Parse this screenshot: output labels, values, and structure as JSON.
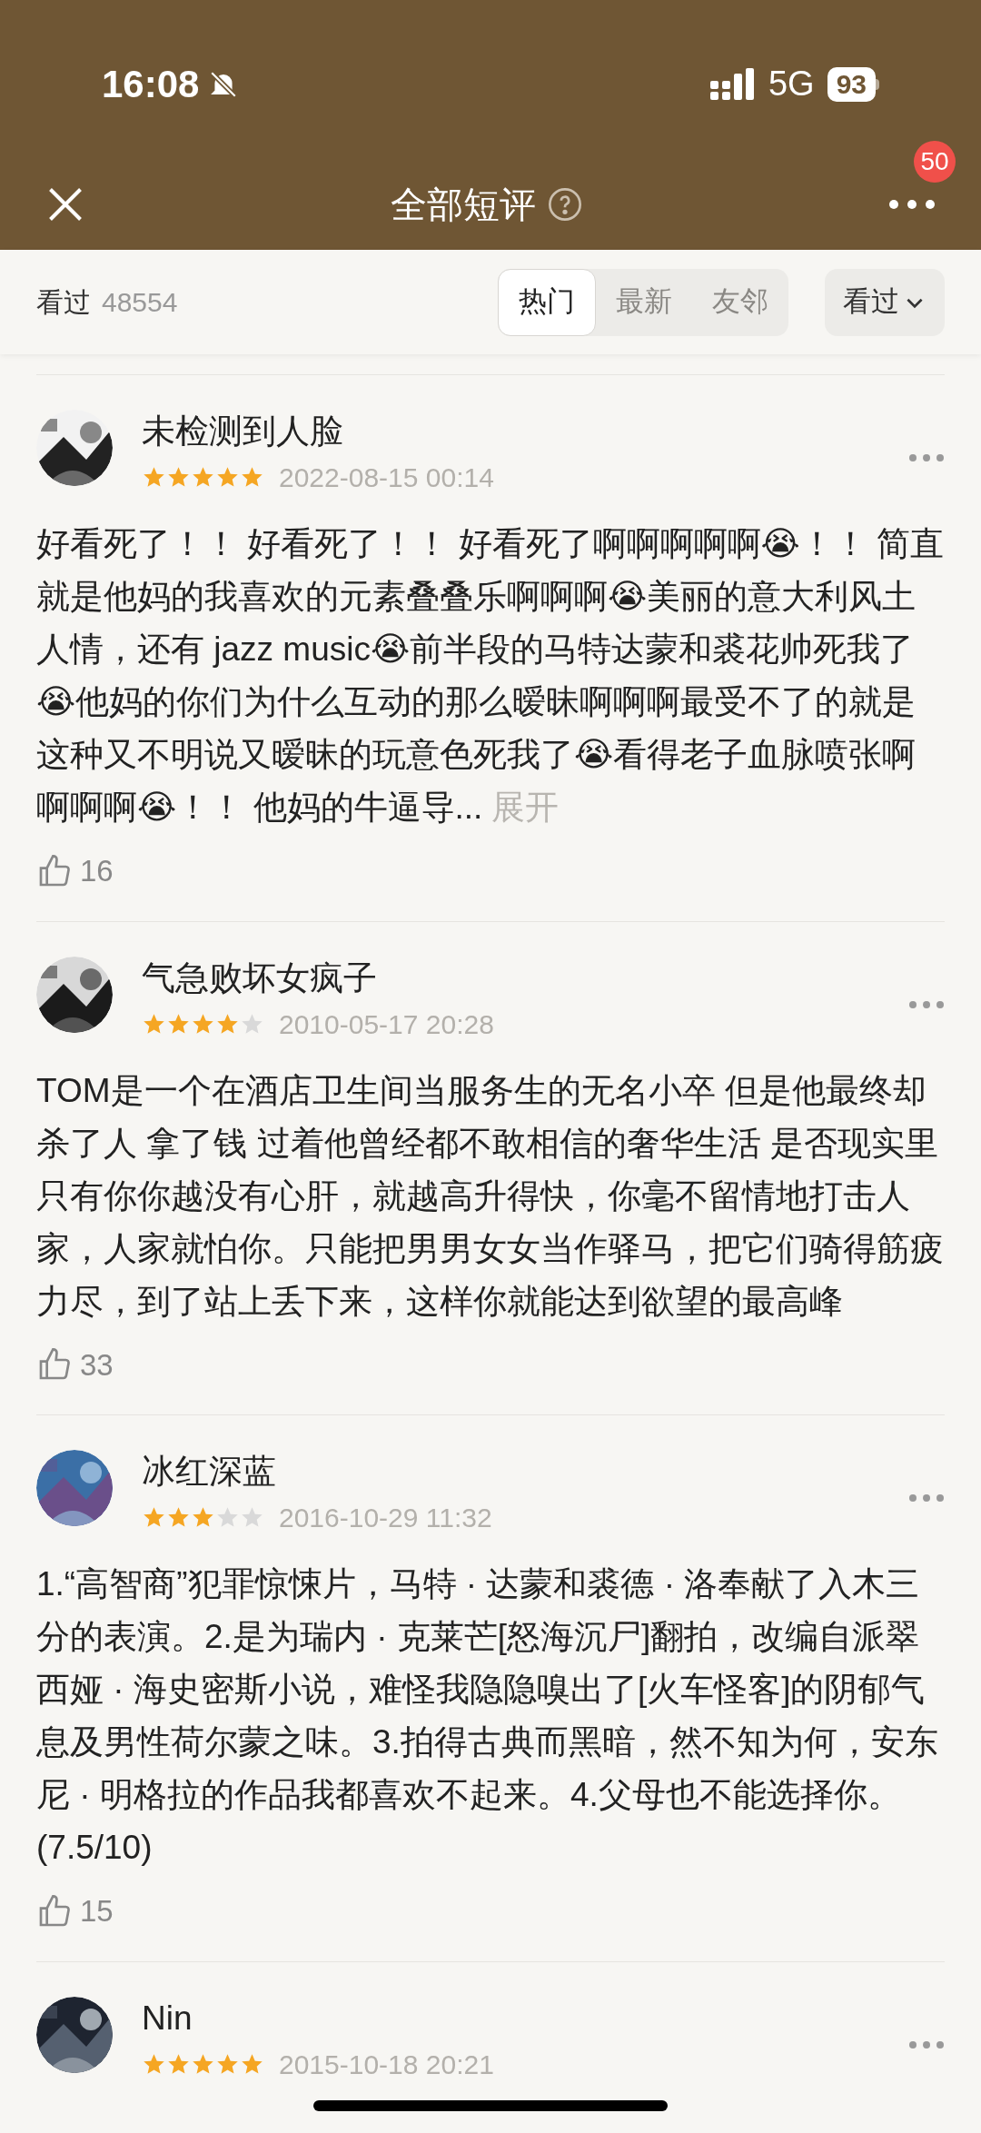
{
  "status_bar": {
    "time": "16:08",
    "network": "5G",
    "battery": "93"
  },
  "nav": {
    "title": "全部短评",
    "badge": "50"
  },
  "filter": {
    "label": "看过",
    "count": "48554",
    "tabs": [
      {
        "label": "热门",
        "selected": true
      },
      {
        "label": "最新",
        "selected": false
      },
      {
        "label": "友邻",
        "selected": false
      }
    ],
    "dropdown": "看过"
  },
  "reviews": [
    {
      "name": "未检测到人脸",
      "stars": 5,
      "date": "2022-08-15 00:14",
      "text": "好看死了！！ 好看死了！！ 好看死了啊啊啊啊啊😭！！ 简直就是他妈的我喜欢的元素叠叠乐啊啊啊😭美丽的意大利风土人情，还有 jazz music😭前半段的马特达蒙和裘花帅死我了😭他妈的你们为什么互动的那么暧昧啊啊啊最受不了的就是这种又不明说又暧昧的玩意色死我了😭看得老子血脉喷张啊啊啊啊😭！！ 他妈的牛逼导...",
      "expand": "展开",
      "likes": "16"
    },
    {
      "name": "气急败坏女疯子",
      "stars": 4,
      "date": "2010-05-17 20:28",
      "text": "TOM是一个在酒店卫生间当服务生的无名小卒 但是他最终却杀了人 拿了钱 过着他曾经都不敢相信的奢华生活 是否现实里只有你你越没有心肝，就越高升得快，你毫不留情地打击人家，人家就怕你。只能把男男女女当作驿马，把它们骑得筋疲力尽，到了站上丢下来，这样你就能达到欲望的最高峰",
      "likes": "33"
    },
    {
      "name": "冰红深蓝",
      "stars": 3,
      "date": "2016-10-29 11:32",
      "text": "1.“高智商”犯罪惊悚片，马特 · 达蒙和裘德 · 洛奉献了入木三分的表演。2.是为瑞内 · 克莱芒[怒海沉尸]翻拍，改编自派翠西娅 · 海史密斯小说，难怪我隐隐嗅出了[火车怪客]的阴郁气息及男性荷尔蒙之味。3.拍得古典而黑暗，然不知为何，安东尼 · 明格拉的作品我都喜欢不起来。4.父母也不能选择你。(7.5/10)",
      "likes": "15"
    },
    {
      "name": "Nin",
      "stars": 5,
      "date": "2015-10-18 20:21"
    }
  ]
}
